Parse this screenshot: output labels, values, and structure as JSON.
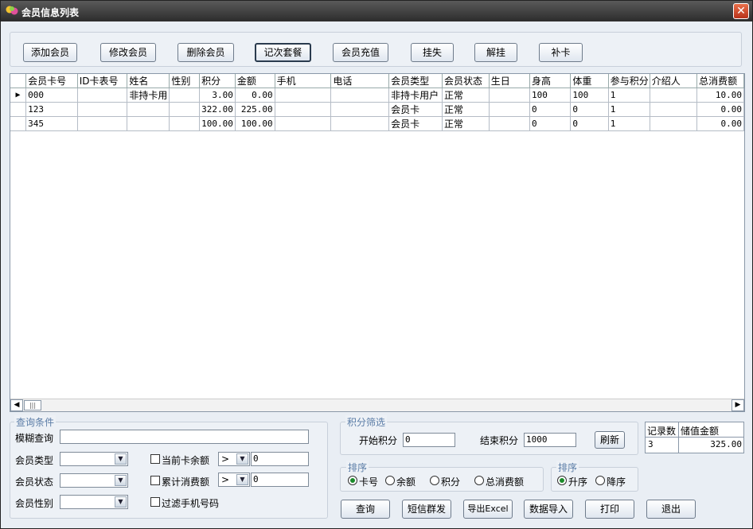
{
  "window": {
    "title": "会员信息列表",
    "close_glyph": "✕"
  },
  "toolbar": {
    "buttons": [
      "添加会员",
      "修改会员",
      "删除会员",
      "记次套餐",
      "会员充值",
      "挂失",
      "解挂",
      "补卡"
    ]
  },
  "grid": {
    "columns": [
      "会员卡号",
      "ID卡表号",
      "姓名",
      "性别",
      "积分",
      "金额",
      "手机",
      "电话",
      "会员类型",
      "会员状态",
      "生日",
      "身高",
      "体重",
      "参与积分",
      "介绍人",
      "总消费额"
    ],
    "rows": [
      [
        "000",
        "",
        "非持卡用",
        "",
        "3.00",
        "0.00",
        "",
        "",
        "非持卡用户",
        "正常",
        "",
        "100",
        "100",
        "1",
        "",
        "10.00"
      ],
      [
        "123",
        "",
        "",
        "",
        "322.00",
        "225.00",
        "",
        "",
        "会员卡",
        "正常",
        "",
        "0",
        "0",
        "1",
        "",
        "0.00"
      ],
      [
        "345",
        "",
        "",
        "",
        "100.00",
        "100.00",
        "",
        "",
        "会员卡",
        "正常",
        "",
        "0",
        "0",
        "1",
        "",
        "0.00"
      ]
    ],
    "current_row_marker": "▶",
    "scroll": {
      "left": "◀",
      "right": "▶",
      "thumb": "|||"
    }
  },
  "query": {
    "legend": "查询条件",
    "fuzzy_label": "模糊查询",
    "fuzzy_value": "",
    "type_label": "会员类型",
    "type_value": "",
    "status_label": "会员状态",
    "status_value": "",
    "gender_label": "会员性别",
    "gender_value": "",
    "balance_label": "当前卡余额",
    "balance_op": ">",
    "balance_value": "0",
    "consume_label": "累计消费额",
    "consume_op": ">",
    "consume_value": "0",
    "filter_phone_label": "过滤手机号码"
  },
  "points_filter": {
    "legend": "积分筛选",
    "start_label": "开始积分",
    "start_value": "0",
    "end_label": "结束积分",
    "end_value": "1000",
    "refresh": "刷新"
  },
  "sort": {
    "legend": "排序",
    "options": [
      "卡号",
      "余额",
      "积分",
      "总消费额"
    ],
    "selected": "卡号"
  },
  "order": {
    "legend": "排序",
    "options": [
      "升序",
      "降序"
    ],
    "selected": "升序"
  },
  "stats": {
    "count_label": "记录数",
    "amount_label": "储值金额",
    "count": "3",
    "amount": "325.00"
  },
  "actions": [
    "查询",
    "短信群发",
    "导出Excel",
    "数据导入",
    "打印",
    "退出"
  ],
  "colors": {
    "title_bg": "#2c2c2c",
    "body_bg": "#e9eef4",
    "legend": "#5a7ca6",
    "radio_dot": "#1a8a2a"
  }
}
